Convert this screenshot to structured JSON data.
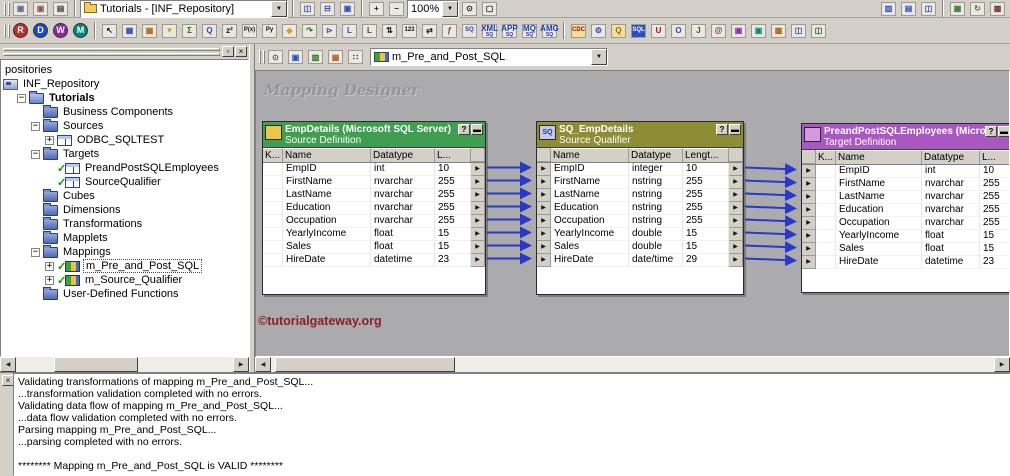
{
  "chrome": {
    "help": "?",
    "minimize": "▬",
    "close": "×",
    "dock": "▫",
    "dropdown": "▼",
    "scroll_left": "◀",
    "scroll_right": "▶",
    "port_arrow": "▶",
    "check": "✓"
  },
  "toolbar1": {
    "repo_combo": "Tutorials - [INF_Repository]",
    "zoom_combo": "100%",
    "group_file": [
      {
        "name": "check-out-icon",
        "text": "▣",
        "fg": "#5a6b8c"
      },
      {
        "name": "check-in-icon",
        "text": "▣",
        "fg": "#8c5a5a"
      },
      {
        "name": "print-icon",
        "text": "▤",
        "fg": "#444444"
      }
    ],
    "group_view": [
      {
        "name": "toggle-navigator-icon",
        "text": "◫",
        "fg": "#2a4fc0"
      },
      {
        "name": "toggle-output-window-icon",
        "text": "⊟",
        "fg": "#2a4fc0"
      },
      {
        "name": "toggle-overview-window-icon",
        "text": "▣",
        "fg": "#2a4fc0"
      }
    ],
    "group_zoom_a": [
      {
        "name": "zoom-in-icon",
        "text": "+",
        "fg": "#1a1a1a"
      },
      {
        "name": "zoom-out-icon",
        "text": "−",
        "fg": "#1a1a1a"
      }
    ],
    "group_zoom_b": [
      {
        "name": "zoom-rect-icon",
        "text": "⊙",
        "fg": "#1a1a1a"
      },
      {
        "name": "fit-to-page-icon",
        "text": "▢",
        "fg": "#1a1a1a"
      }
    ],
    "group_window": [
      {
        "name": "arrange-horizontal-icon",
        "text": "▥",
        "fg": "#2a4fc0"
      },
      {
        "name": "arrange-vertical-icon",
        "text": "▤",
        "fg": "#2a4fc0"
      },
      {
        "name": "cascade-windows-icon",
        "text": "◫",
        "fg": "#2a4fc0"
      }
    ],
    "group_misc": [
      {
        "name": "new-window-icon",
        "text": "▦",
        "fg": "#3a7a3a"
      },
      {
        "name": "refresh-icon",
        "text": "↻",
        "fg": "#3a7a3a"
      },
      {
        "name": "options-icon",
        "text": "▩",
        "fg": "#7a3a3a"
      }
    ]
  },
  "toolbar2": {
    "tools": [
      {
        "name": "repository-manager-icon",
        "text": "R",
        "bg": "#c62828",
        "fg": "#ffffff",
        "shape": "circle"
      },
      {
        "name": "designer-icon",
        "text": "D",
        "bg": "#1a49c8",
        "fg": "#ffffff",
        "shape": "circle"
      },
      {
        "name": "workflow-manager-icon",
        "text": "W",
        "bg": "#8e24aa",
        "fg": "#ffffff",
        "shape": "circle"
      },
      {
        "name": "workflow-monitor-icon",
        "text": "M",
        "bg": "#00897b",
        "fg": "#ffffff",
        "shape": "circle"
      }
    ],
    "transformations": [
      {
        "name": "select-tool-icon",
        "text": "↖",
        "fg": "#111111"
      },
      {
        "name": "create-source-icon",
        "text": "▦",
        "fg": "#2a4fc0"
      },
      {
        "name": "edit-tables-icon",
        "text": "▦",
        "fg": "#b5651d"
      },
      {
        "name": "filter-transformation-icon",
        "text": "▼",
        "fg": "#c9a227"
      },
      {
        "name": "aggregator-transformation-icon",
        "text": "Σ",
        "fg": "#1c6b1c"
      },
      {
        "name": "lookup-transformation-icon",
        "text": "Q",
        "fg": "#2a4fc0"
      },
      {
        "name": "expression-transformation-icon",
        "text": "z²",
        "fg": "#111111"
      },
      {
        "name": "rank-transformation-icon",
        "text": "P(x)",
        "small": true,
        "fg": "#111111"
      },
      {
        "name": "router-transformation-icon",
        "text": "Py",
        "small": true,
        "fg": "#111111"
      },
      {
        "name": "normalizer-transformation-icon",
        "text": "◆",
        "fg": "#c9a227"
      },
      {
        "name": "update-strategy-icon",
        "text": "↷",
        "fg": "#1c6b1c"
      },
      {
        "name": "joiner-transformation-icon",
        "text": "⊳",
        "fg": "#2a4fc0"
      },
      {
        "name": "lookup-unconnected-icon",
        "text": "L",
        "fg": "#2a4fc0"
      },
      {
        "name": "lookup-dynamic-icon",
        "text": "L",
        "fg": "#1c6b1c"
      },
      {
        "name": "sorter-transformation-icon",
        "text": "⇅",
        "fg": "#111111"
      },
      {
        "name": "sequence-generator-icon",
        "text": "123",
        "small": true,
        "fg": "#111111"
      },
      {
        "name": "transaction-control-icon",
        "text": "⇄",
        "fg": "#111111"
      },
      {
        "name": "stored-procedure-icon",
        "text": "ƒ",
        "fg": "#7a3a3a"
      },
      {
        "name": "source-qualifier-icon",
        "text": "SQ",
        "small": true,
        "fg": "#1a3ab8"
      },
      {
        "name": "xml-source-qualifier-icon",
        "text": "XML",
        "text2": "SQ",
        "fg": "#1a3ab8"
      },
      {
        "name": "application-source-qualifier-icon",
        "text": "APP",
        "text2": "SQ",
        "fg": "#1a3ab8"
      },
      {
        "name": "mq-source-qualifier-icon",
        "text": "MQ",
        "text2": "SQ",
        "fg": "#1a3ab8"
      },
      {
        "name": "amg-source-qualifier-icon",
        "text": "AMG",
        "text2": "SQ",
        "fg": "#1a3ab8"
      }
    ],
    "advanced": [
      {
        "name": "cdc-source-icon",
        "text": "CDC",
        "small": true,
        "fg": "#b00020",
        "bg": "#f6df9a"
      },
      {
        "name": "custom-transformation-icon",
        "text": "⚙",
        "fg": "#2a4fc0"
      },
      {
        "name": "data-quality-icon",
        "text": "Q",
        "fg": "#8a6d1a",
        "bg": "#f6df9a"
      },
      {
        "name": "sql-transformation-icon",
        "text": "SQL",
        "small": true,
        "fg": "#ffffff",
        "bg": "#2a4fc0"
      },
      {
        "name": "union-transformation-icon",
        "text": "U",
        "fg": "#b00020"
      },
      {
        "name": "unstructured-data-icon",
        "text": "O",
        "fg": "#2a4fc0"
      },
      {
        "name": "java-transformation-icon",
        "text": "J",
        "fg": "#1c6b1c"
      },
      {
        "name": "http-transformation-icon",
        "text": "@",
        "fg": "#7a3a1d"
      },
      {
        "name": "idoc-interpreter-icon",
        "text": "▣",
        "fg": "#8e24aa"
      },
      {
        "name": "idoc-prepare-icon",
        "text": "▣",
        "fg": "#00897b"
      },
      {
        "name": "data-masking-icon",
        "text": "▩",
        "fg": "#b5651d"
      },
      {
        "name": "mapplet-input-icon",
        "text": "◫",
        "fg": "#2a4fc0"
      },
      {
        "name": "mapplet-output-icon",
        "text": "◫",
        "fg": "#1c6b1c"
      }
    ]
  },
  "designer_toolbar": {
    "mapping_combo": "m_Pre_and_Post_SQL",
    "icons": [
      {
        "name": "zoom-tool-icon",
        "text": "⊙",
        "fg": "#555555"
      },
      {
        "name": "iconize-workspace-icon",
        "text": "▣",
        "fg": "#2a4fc0"
      },
      {
        "name": "arrange-workspace-icon",
        "text": "▥",
        "fg": "#1c6b1c"
      },
      {
        "name": "arrange-iconic-icon",
        "text": "▦",
        "fg": "#b5651d"
      },
      {
        "name": "link-columns-icon",
        "text": "∷",
        "fg": "#111111"
      }
    ]
  },
  "tree": {
    "items": [
      {
        "label": "positories",
        "depth": 0
      },
      {
        "label": "INF_Repository",
        "depth": 0,
        "icon": "repository",
        "nospacer": true
      },
      {
        "label": "Tutorials",
        "depth": 1,
        "icon": "folder-open",
        "expander": "minus",
        "bold": true
      },
      {
        "label": "Business Components",
        "depth": 2,
        "icon": "folder"
      },
      {
        "label": "Sources",
        "depth": 2,
        "icon": "folder",
        "expander": "minus"
      },
      {
        "label": "ODBC_SQLTEST",
        "depth": 3,
        "icon": "source",
        "expander": "plus"
      },
      {
        "label": "Targets",
        "depth": 2,
        "icon": "folder",
        "expander": "minus"
      },
      {
        "label": "PreandPostSQLEmployees",
        "depth": 3,
        "icon": "target",
        "check": true
      },
      {
        "label": "SourceQualifier",
        "depth": 3,
        "icon": "target",
        "check": true
      },
      {
        "label": "Cubes",
        "depth": 2,
        "icon": "folder"
      },
      {
        "label": "Dimensions",
        "depth": 2,
        "icon": "folder"
      },
      {
        "label": "Transformations",
        "depth": 2,
        "icon": "folder"
      },
      {
        "label": "Mapplets",
        "depth": 2,
        "icon": "folder"
      },
      {
        "label": "Mappings",
        "depth": 2,
        "icon": "folder",
        "expander": "minus"
      },
      {
        "label": "m_Pre_and_Post_SQL",
        "depth": 3,
        "icon": "mapping",
        "expander": "plus",
        "check": true,
        "selected": true
      },
      {
        "label": "m_Source_Qualifier",
        "depth": 3,
        "icon": "mapping",
        "expander": "plus",
        "check": true
      },
      {
        "label": "User-Defined Functions",
        "depth": 2,
        "icon": "folder"
      }
    ]
  },
  "canvas": {
    "watermark": "Mapping Designer",
    "copyright": "©tutorialgateway.org",
    "link_color": "#2839c8",
    "tables": [
      {
        "title": "EmpDetails (Microsoft SQL Server)",
        "subtitle": "Source Definition",
        "header_color": "#3f9e4f",
        "icon_label": "",
        "icon_bg": "#e8c84a",
        "columns": [
          "K...",
          "Name",
          "Datatype",
          "L..."
        ],
        "ports": {
          "left": false,
          "right": true
        },
        "rows": [
          [
            "",
            "EmpID",
            "int",
            "10"
          ],
          [
            "",
            "FirstName",
            "nvarchar",
            "255"
          ],
          [
            "",
            "LastName",
            "nvarchar",
            "255"
          ],
          [
            "",
            "Education",
            "nvarchar",
            "255"
          ],
          [
            "",
            "Occupation",
            "nvarchar",
            "255"
          ],
          [
            "",
            "YearlyIncome",
            "float",
            "15"
          ],
          [
            "",
            "Sales",
            "float",
            "15"
          ],
          [
            "",
            "HireDate",
            "datetime",
            "23"
          ]
        ]
      },
      {
        "title": "SQ_EmpDetails",
        "subtitle": "Source Qualifier",
        "header_color": "#8d8d35",
        "icon_label": "SQ",
        "icon_bg": "#c8c8e0",
        "icon_fg": "#1a3ab8",
        "columns": [
          "Name",
          "Datatype",
          "Lengt..."
        ],
        "ports": {
          "left": true,
          "right": true
        },
        "rows": [
          [
            "EmpID",
            "integer",
            "10"
          ],
          [
            "FirstName",
            "nstring",
            "255"
          ],
          [
            "LastName",
            "nstring",
            "255"
          ],
          [
            "Education",
            "nstring",
            "255"
          ],
          [
            "Occupation",
            "nstring",
            "255"
          ],
          [
            "YearlyIncome",
            "double",
            "15"
          ],
          [
            "Sales",
            "double",
            "15"
          ],
          [
            "HireDate",
            "date/time",
            "29"
          ]
        ]
      },
      {
        "title": "PreandPostSQLEmployees (Micro...",
        "subtitle": "Target Definition",
        "header_color": "#a958c2",
        "icon_label": "",
        "icon_bg": "#d898e0",
        "columns": [
          "K...",
          "Name",
          "Datatype",
          "L..."
        ],
        "ports": {
          "left": true,
          "right": false
        },
        "rows": [
          [
            "",
            "EmpID",
            "int",
            "10"
          ],
          [
            "",
            "FirstName",
            "nvarchar",
            "255"
          ],
          [
            "",
            "LastName",
            "nvarchar",
            "255"
          ],
          [
            "",
            "Education",
            "nvarchar",
            "255"
          ],
          [
            "",
            "Occupation",
            "nvarchar",
            "255"
          ],
          [
            "",
            "YearlyIncome",
            "float",
            "15"
          ],
          [
            "",
            "Sales",
            "float",
            "15"
          ],
          [
            "",
            "HireDate",
            "datetime",
            "23"
          ]
        ]
      }
    ]
  },
  "output": {
    "lines": [
      "Validating transformations of mapping m_Pre_and_Post_SQL...",
      "...transformation validation completed with no errors.",
      "Validating data flow of mapping m_Pre_and_Post_SQL...",
      "...data flow validation completed with no errors.",
      "Parsing mapping m_Pre_and_Post_SQL...",
      "...parsing completed with no errors.",
      "",
      "******** Mapping m_Pre_and_Post_SQL is VALID ********"
    ]
  }
}
